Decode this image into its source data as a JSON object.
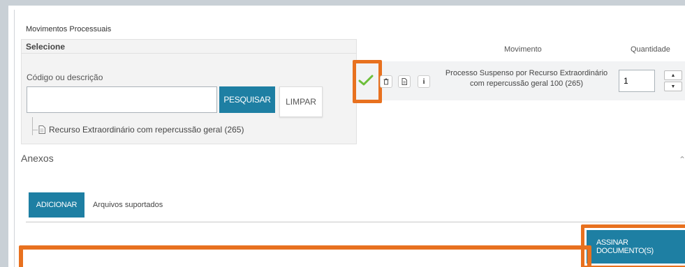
{
  "section": {
    "title": "Movimentos Processuais"
  },
  "select": {
    "header": "Selecione",
    "field_label": "Código ou descrição",
    "search_value": "",
    "search_button": "PESQUISAR",
    "clear_button": "LIMPAR",
    "tree_item": "Recurso Extraordinário com repercussão geral (265)"
  },
  "movimento": {
    "col_movimento": "Movimento",
    "col_quantidade": "Quantidade",
    "row": {
      "desc_line1": "Processo Suspenso por Recurso Extraordinário",
      "desc_line2": "com repercussão geral 100 (265)",
      "quantity": "1",
      "info_label": "i"
    }
  },
  "anexos": {
    "title": "Anexos",
    "add_button": "ADICIONAR",
    "supported_label": "Arquivos suportados"
  },
  "footer": {
    "sign_button": "ASSINAR DOCUMENTO(S)"
  },
  "colors": {
    "primary": "#1e7fa3",
    "highlight": "#e8711f",
    "check": "#6cbf3a"
  }
}
